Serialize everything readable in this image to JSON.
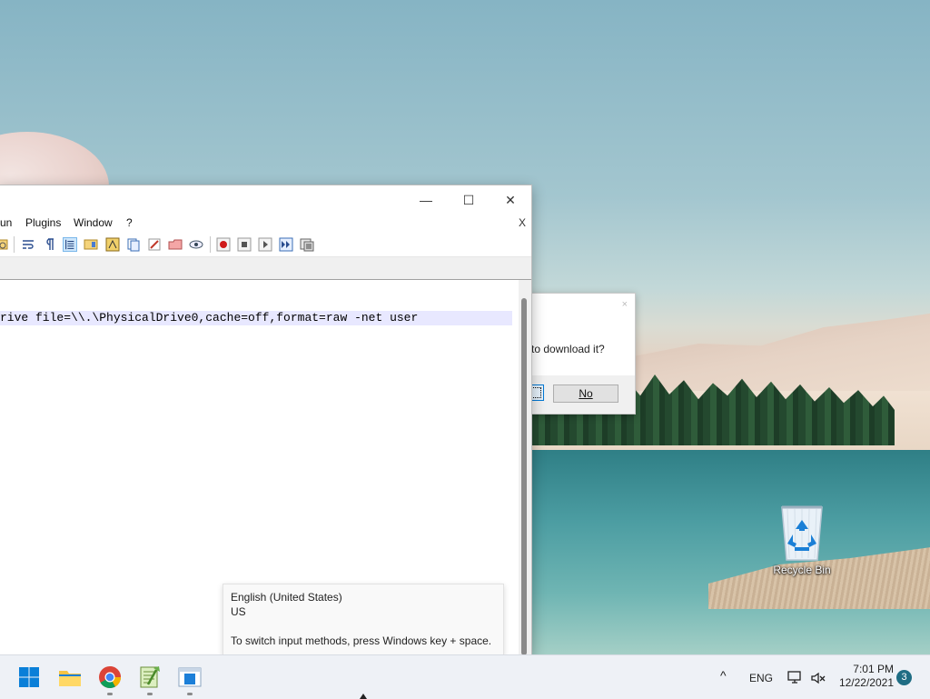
{
  "desktop": {
    "recycle_bin_label": "Recycle Bin"
  },
  "dialog": {
    "message": "to download it?",
    "close_symbol": "×",
    "no_button": "No"
  },
  "notepad": {
    "window_controls": {
      "minimize": "—",
      "maximize": "☐",
      "close": "✕"
    },
    "menu": [
      "un",
      "Plugins",
      "Window",
      "?"
    ],
    "menu_close": "X",
    "code_line": "rive file=\\\\.\\PhysicalDrive0,cache=off,format=raw -net user"
  },
  "language_tooltip": {
    "language": "English (United States)",
    "layout": "US",
    "hint": "To switch input methods, press Windows key + space."
  },
  "taskbar": {
    "tray_chevron": "^",
    "language": "ENG",
    "time": "7:01 PM",
    "date": "12/22/2021",
    "notification_count": "3"
  },
  "colors": {
    "windows_blue": "#0078d4",
    "line_highlight": "#e8e8ff",
    "notification_badge": "#1f6d84"
  }
}
